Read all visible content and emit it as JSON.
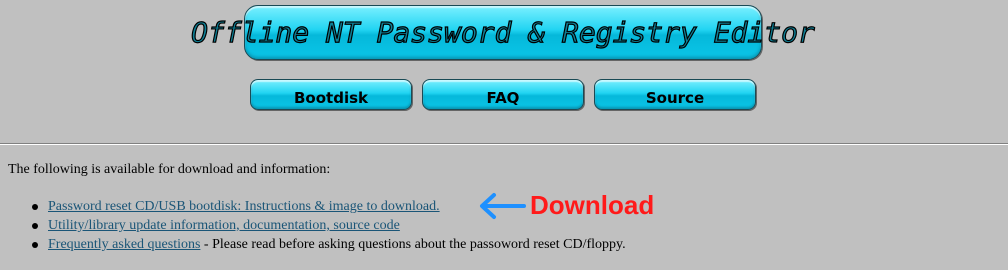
{
  "header": {
    "title": "Offline NT Password & Registry Editor"
  },
  "nav": {
    "bootdisk": "Bootdisk",
    "faq": "FAQ",
    "source": "Source"
  },
  "content": {
    "intro": "The following is available for download and information:",
    "links": [
      {
        "link_text": "Password reset CD/USB bootdisk: Instructions & image to download.",
        "suffix": ""
      },
      {
        "link_text": "Utility/library update information, documentation, source code",
        "suffix": ""
      },
      {
        "link_text": "Frequently asked questions",
        "suffix": " - Please read before asking questions about the passoword reset CD/floppy."
      }
    ]
  },
  "annotation": {
    "label": "Download",
    "color": "#ff1a1a",
    "arrow_color": "#1e90ff"
  },
  "colors": {
    "background": "#c0c0c0",
    "button_cyan": "#21d4f2",
    "link": "#1a5577"
  }
}
